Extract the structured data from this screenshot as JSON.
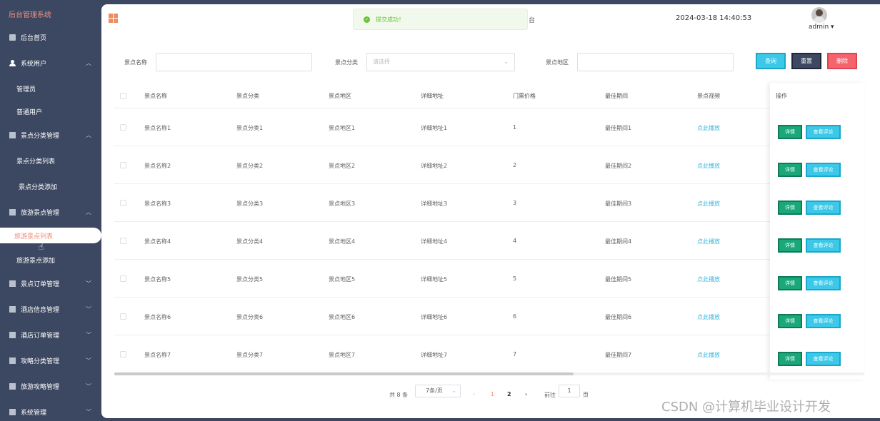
{
  "sidebar": {
    "title": "后台管理系统",
    "items": [
      {
        "label": "后台首页",
        "chev": ""
      },
      {
        "label": "系统用户",
        "chev": "^"
      },
      {
        "label": "景点分类管理",
        "chev": "^"
      },
      {
        "label": "旅游景点管理",
        "chev": "^"
      },
      {
        "label": "景点订单管理",
        "chev": "v"
      },
      {
        "label": "酒店信息管理",
        "chev": "v"
      },
      {
        "label": "酒店订单管理",
        "chev": "v"
      },
      {
        "label": "攻略分类管理",
        "chev": "v"
      },
      {
        "label": "旅游攻略管理",
        "chev": "v"
      },
      {
        "label": "系统管理",
        "chev": "v"
      }
    ],
    "subs": {
      "admin": "管理员",
      "normal_user": "普通用户",
      "category_list": "景点分类列表",
      "category_add": "景点分类添加",
      "spot_list": "旅游景点列表",
      "spot_add": "旅游景点添加"
    }
  },
  "header": {
    "toast": "提交成功！",
    "toast_tail": "台",
    "datetime": "2024-03-18 14:40:53",
    "user": "admin ▾"
  },
  "search": {
    "name_label": "景点名称",
    "category_label": "景点分类",
    "category_placeholder": "请选择",
    "region_label": "景点地区",
    "query": "查询",
    "reset": "重置",
    "delete": "删除"
  },
  "table": {
    "headers": [
      "景点名称",
      "景点分类",
      "景点地区",
      "详细地址",
      "门票价格",
      "最佳期间",
      "景点视频",
      "操作"
    ],
    "rows": [
      {
        "name": "景点名称1",
        "category": "景点分类1",
        "region": "景点地区1",
        "address": "详细地址1",
        "price": "1",
        "period": "最佳期间1",
        "video": "点此播放"
      },
      {
        "name": "景点名称2",
        "category": "景点分类2",
        "region": "景点地区2",
        "address": "详细地址2",
        "price": "2",
        "period": "最佳期间2",
        "video": "点此播放"
      },
      {
        "name": "景点名称3",
        "category": "景点分类3",
        "region": "景点地区3",
        "address": "详细地址3",
        "price": "3",
        "period": "最佳期间3",
        "video": "点此播放"
      },
      {
        "name": "景点名称4",
        "category": "景点分类4",
        "region": "景点地区4",
        "address": "详细地址4",
        "price": "4",
        "period": "最佳期间4",
        "video": "点此播放"
      },
      {
        "name": "景点名称5",
        "category": "景点分类5",
        "region": "景点地区5",
        "address": "详细地址5",
        "price": "5",
        "period": "最佳期间5",
        "video": "点此播放"
      },
      {
        "name": "景点名称6",
        "category": "景点分类6",
        "region": "景点地区6",
        "address": "详细地址6",
        "price": "6",
        "period": "最佳期间6",
        "video": "点此播放"
      },
      {
        "name": "景点名称7",
        "category": "景点分类7",
        "region": "景点地区7",
        "address": "详细地址7",
        "price": "7",
        "period": "最佳期间7",
        "video": "点此播放"
      }
    ],
    "detail_btn": "详情",
    "comment_btn": "查看评论"
  },
  "pagination": {
    "total": "共 8 条",
    "page_size": "7条/页",
    "prev": "‹",
    "pages": [
      "1",
      "2"
    ],
    "next": "›",
    "goto": "前往",
    "goto_value": "1",
    "page_suffix": "页"
  },
  "watermark": "CSDN @计算机毕业设计开发",
  "colors": {
    "accent": "#f08c7e",
    "sidebar": "#3c4862",
    "link": "#3cb8e0",
    "detail": "#1aa87a"
  }
}
